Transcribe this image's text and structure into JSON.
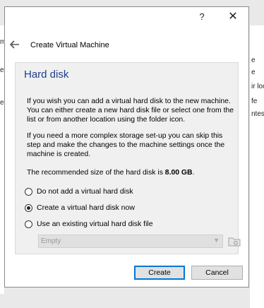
{
  "background": {
    "right_fragments": [
      "e",
      "e",
      "ir loc",
      "fe",
      "ntest"
    ],
    "left_fragments": [
      "m",
      "e",
      "e"
    ]
  },
  "titlebar": {
    "help_glyph": "?",
    "close_glyph": "✕"
  },
  "wizard": {
    "title": "Create Virtual Machine",
    "back_icon": "back-arrow-icon"
  },
  "page": {
    "title": "Hard disk",
    "paragraph1": "If you wish you can add a virtual hard disk to the new machine. You can either create a new hard disk file or select one from the list or from another location using the folder icon.",
    "paragraph2": "If you need a more complex storage set-up you can skip this step and make the changes to the machine settings once the machine is created.",
    "recommended_prefix": "The recommended size of the hard disk is ",
    "recommended_size": "8.00 GB",
    "recommended_suffix": "."
  },
  "options": [
    {
      "label": "Do not add a virtual hard disk",
      "selected": false
    },
    {
      "label": "Create a virtual hard disk now",
      "selected": true
    },
    {
      "label": "Use an existing virtual hard disk file",
      "selected": false
    }
  ],
  "disk_select": {
    "value": "Empty",
    "enabled": false,
    "arrow": "▼"
  },
  "buttons": {
    "create": "Create",
    "cancel": "Cancel"
  },
  "colors": {
    "accent": "#0078d7",
    "title_blue": "#1c3f86"
  }
}
